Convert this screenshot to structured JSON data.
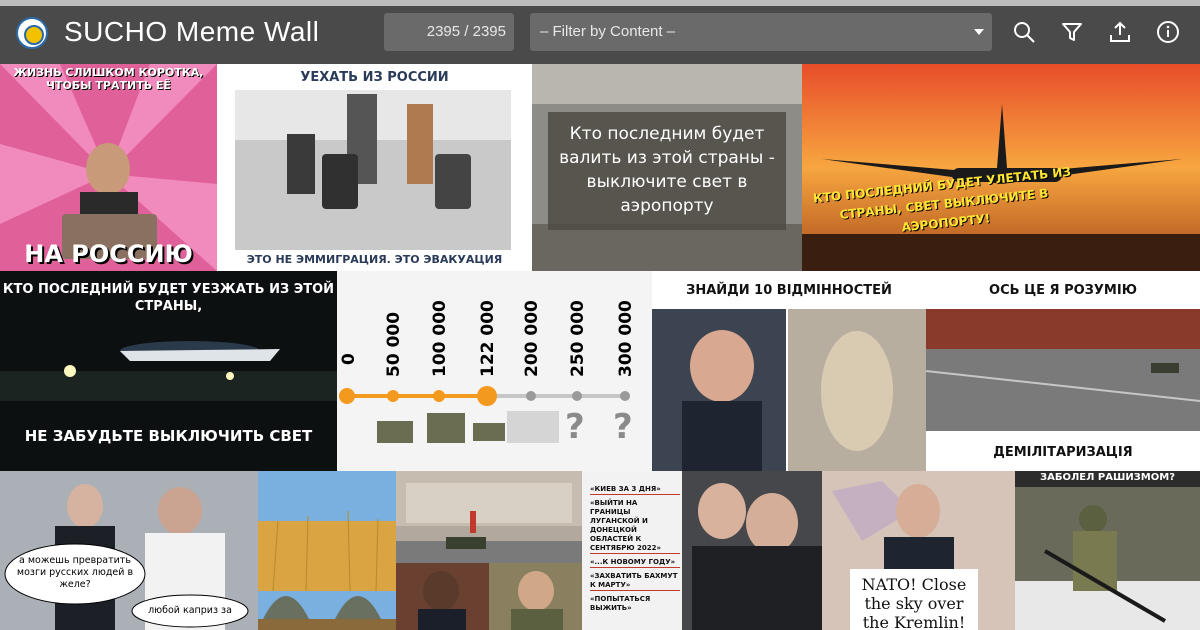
{
  "header": {
    "title": "SUCHO Meme Wall",
    "counter": "2395 / 2395",
    "filter_placeholder": "– Filter by Content –",
    "icons": [
      "search-icon",
      "filter-icon",
      "upload-icon",
      "info-icon"
    ]
  },
  "memes": {
    "m1": {
      "top": "ЖИЗНЬ СЛИШКОМ КОРОТКА, ЧТОБЫ ТРАТИТЬ ЕЁ",
      "bottom": "НА РОССИЮ"
    },
    "m2": {
      "top": "УЕХАТЬ ИЗ РОССИИ",
      "bottom": "ЭТО НЕ ЭММИГРАЦИЯ. ЭТО ЭВАКУАЦИЯ"
    },
    "m3": {
      "text": "Кто последним будет валить из этой страны - выключите свет в аэропорту"
    },
    "m4": {
      "text": "КТО ПОСЛЕДНИЙ БУДЕТ УЛЕТАТЬ ИЗ СТРАНЫ, СВЕТ ВЫКЛЮЧИТЕ В АЭРОПОРТУ!"
    },
    "m5": {
      "top": "КТО ПОСЛЕДНИЙ БУДЕТ УЕЗЖАТЬ ИЗ ЭТОЙ СТРАНЫ,",
      "bottom": "НЕ ЗАБУДЬТЕ ВЫКЛЮЧИТЬ СВЕТ"
    },
    "m6": {
      "ticks": [
        "0",
        "50 000",
        "100 000",
        "122 000",
        "200 000",
        "250 000",
        "300 000"
      ],
      "q": "?"
    },
    "m7": {
      "text": "ЗНАЙДИ 10 ВІДМІННОСТЕЙ"
    },
    "m8": {
      "top": "ОСЬ ЦЕ Я РОЗУМІЮ",
      "bottom": "ДЕМІЛІТАРИЗАЦІЯ"
    },
    "m9": {
      "bubble1": "а можешь превратить мозги русских людей в желе?",
      "bubble2": "любой каприз за"
    },
    "m13": {
      "lines": [
        "«КИЕВ ЗА 3 ДНЯ»",
        "«ВЫЙТИ НА ГРАНИЦЫ ЛУГАНСКОЙ И ДОНЕЦКОЙ ОБЛАСТЕЙ К СЕНТЯБРЮ 2022»",
        "«...К НОВОМУ ГОДУ»",
        "«ЗАХВАТИТЬ БАХМУТ К МАРТУ»",
        "«ПОПЫТАТЬСЯ ВЫЖИТЬ»"
      ]
    },
    "m14": {
      "sign": "NATO! Close the sky over the Kremlin!"
    },
    "m15": {
      "text": "ЗАБОЛЕЛ РАШИЗМОМ?"
    }
  },
  "colors": {
    "header_bg": "#4a4a4a",
    "field_bg": "#6a6a6a",
    "accent_orange": "#f39a1e"
  }
}
